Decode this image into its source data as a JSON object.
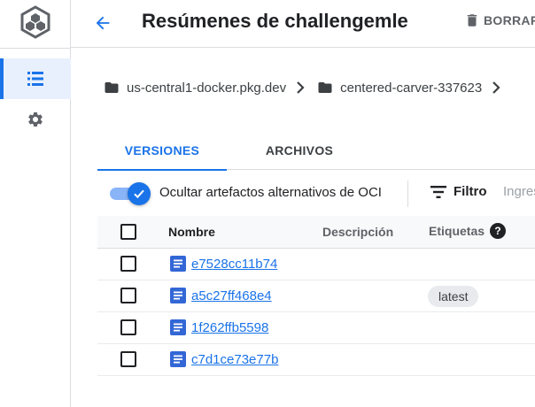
{
  "header": {
    "title": "Resúmenes de challengemle",
    "delete_label": "BORRAR"
  },
  "breadcrumb": [
    {
      "label": "us-central1-docker.pkg.dev"
    },
    {
      "label": "centered-carver-337623"
    }
  ],
  "tabs": [
    {
      "label": "VERSIONES",
      "active": true
    },
    {
      "label": "ARCHIVOS",
      "active": false
    }
  ],
  "toolbar": {
    "toggle_label": "Ocultar artefactos alternativos de OCI",
    "toggle_on": true,
    "filter_label": "Filtro",
    "filter_placeholder": "Ingresar nombre o valor de propiedad"
  },
  "table": {
    "columns": {
      "name": "Nombre",
      "description": "Descripción",
      "tags": "Etiquetas",
      "help": "?"
    },
    "rows": [
      {
        "name": "e7528cc11b74",
        "tag": ""
      },
      {
        "name": "a5c27ff468e4",
        "tag": "latest"
      },
      {
        "name": "1f262ffb5598",
        "tag": ""
      },
      {
        "name": "c7d1ce73e77b",
        "tag": ""
      }
    ]
  },
  "icons": {
    "rail_logo": "artifact-registry-logo-icon",
    "rail_list": "list-icon",
    "rail_settings": "gear-icon",
    "back": "arrow-back-icon",
    "delete": "trash-icon",
    "folder": "folder-icon",
    "chevron": "chevron-right-icon",
    "check": "check-icon",
    "filter": "filter-icon",
    "help": "help-circle-icon",
    "document": "document-icon"
  },
  "colors": {
    "accent": "#1a73e8",
    "accent_light": "#e8f0fe",
    "toggle_track": "#8ab4f8",
    "chip_bg": "#e8eaed"
  }
}
